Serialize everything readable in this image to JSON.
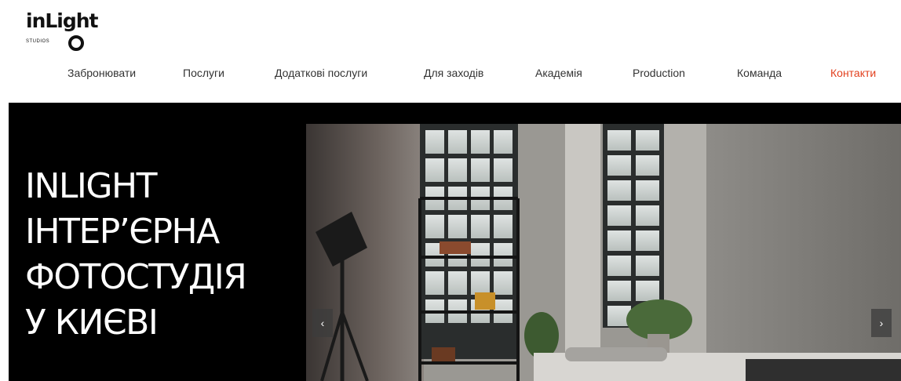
{
  "logo": {
    "main": "inLight",
    "sub": "STUDIOS"
  },
  "nav": {
    "items": [
      {
        "label": "Забронювати",
        "name": "nav-item-book"
      },
      {
        "label": "Послуги",
        "name": "nav-item-services"
      },
      {
        "label": "Додаткові послуги",
        "name": "nav-item-extra-services"
      },
      {
        "label": "Для заходів",
        "name": "nav-item-events"
      },
      {
        "label": "Академія",
        "name": "nav-item-academy"
      },
      {
        "label": "Production",
        "name": "nav-item-production"
      },
      {
        "label": "Команда",
        "name": "nav-item-team"
      },
      {
        "label": "Контакти",
        "name": "nav-item-contacts"
      }
    ],
    "active_index": 7
  },
  "hero": {
    "title": "INLIGHT\nІНТЕР’ЄРНА\nФОТОСТУДІЯ\nУ КИЄВІ",
    "prev_icon": "‹",
    "next_icon": "›"
  },
  "colors": {
    "accent": "#e2401e",
    "hero_bg": "#000000",
    "text": "#333333"
  }
}
